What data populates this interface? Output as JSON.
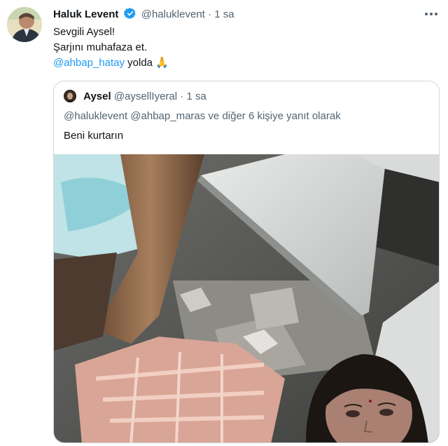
{
  "tweet": {
    "author_name": "Haluk Levent",
    "author_handle": "@haluklevent",
    "separator": "·",
    "time": "1 sa",
    "lines": {
      "line1": "Sevgili Aysel!",
      "line2": "Şarjını muhafaza et.",
      "mention": "@ahbap_hatay",
      "line3_rest": " yolda 🙏"
    }
  },
  "quote": {
    "author_name": "Aysel",
    "author_handle": "@aysellIyeral",
    "separator": "·",
    "time": "1 sa",
    "reply_mention1": "@haluklevent",
    "reply_mention2": "@ahbap_maras",
    "reply_rest": "  ve diğer 6 kişiye yanıt olarak",
    "text": "Beni kurtarın"
  },
  "colors": {
    "accent": "#1d9bf0",
    "muted": "#536471",
    "border": "#cfd9de"
  },
  "icons": {
    "verified": "verified-badge-icon",
    "more": "more-options-icon"
  }
}
